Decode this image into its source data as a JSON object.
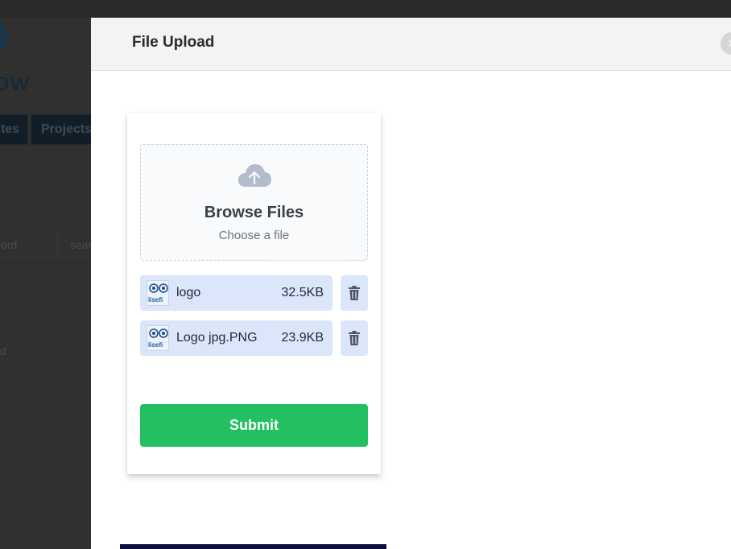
{
  "background": {
    "brand": "ow",
    "nav": [
      "tes",
      "Projects"
    ],
    "inputs": [
      "ord",
      "sear"
    ],
    "text": "d"
  },
  "modal": {
    "title": "File Upload",
    "close_label": "×"
  },
  "upload": {
    "browse_title": "Browse Files",
    "browse_subtitle": "Choose a file",
    "files": [
      {
        "name": "logo",
        "size": "32.5KB",
        "thumb_text": "lisefi"
      },
      {
        "name": "Logo jpg.PNG",
        "size": "23.9KB",
        "thumb_text": "lisefi"
      }
    ],
    "submit_label": "Submit"
  },
  "colors": {
    "submit": "#22c061",
    "file_row": "#dbe6fb",
    "icon_gray": "#4b5563"
  },
  "icons": {
    "upload": "cloud-upload-icon",
    "delete": "trash-icon",
    "close": "close-icon"
  }
}
